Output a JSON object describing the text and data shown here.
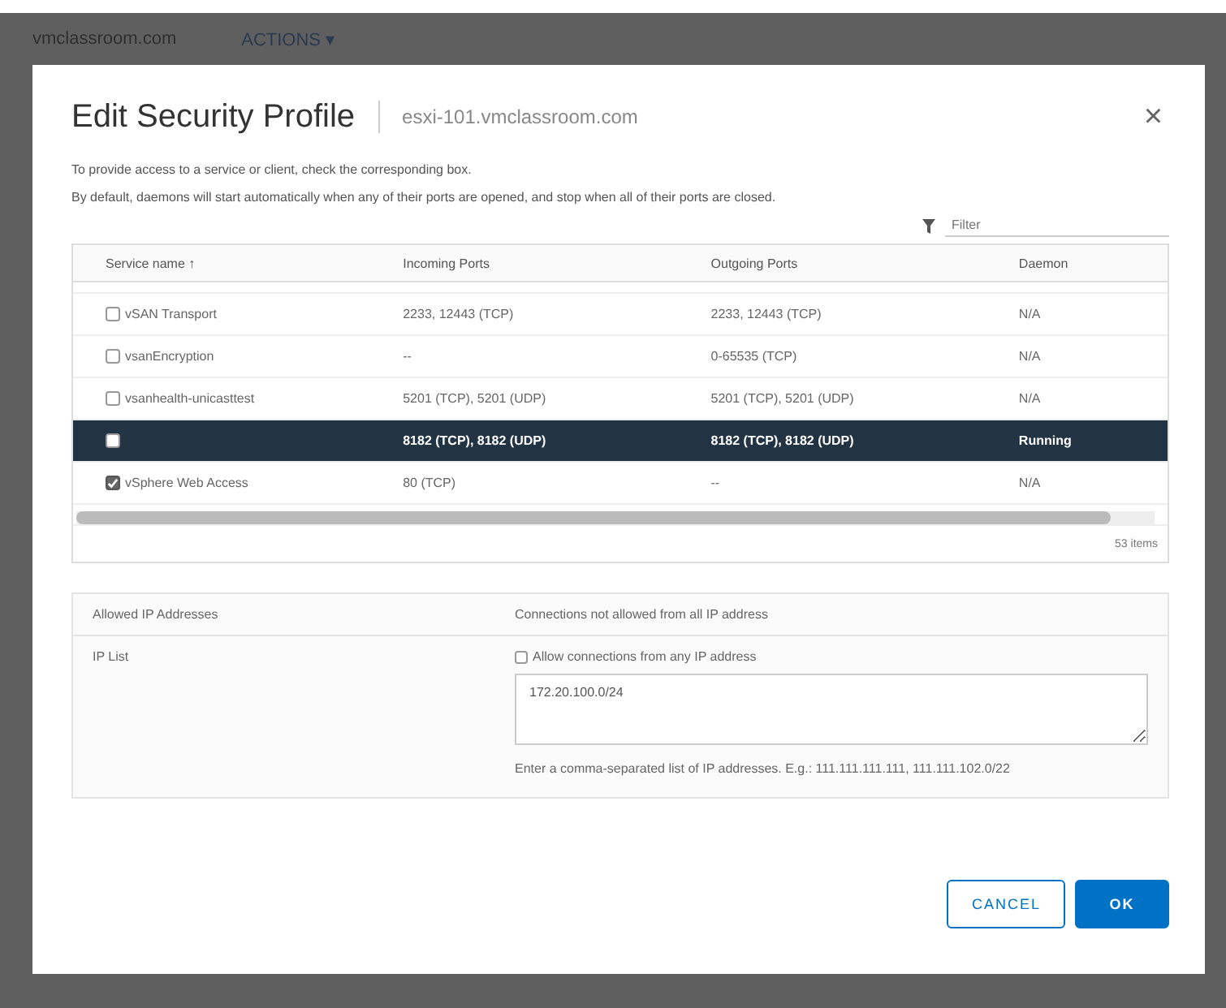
{
  "backdrop": {
    "host": "vmclassroom.com",
    "actions": "ACTIONS ▾"
  },
  "dialog": {
    "title": "Edit Security Profile",
    "subtitle": "esxi-101.vmclassroom.com",
    "close": "×",
    "intro": [
      "To provide access to a service or client, check the corresponding box.",
      "By default, daemons will start automatically when any of their ports are opened, and stop when all of their ports are closed."
    ],
    "filter": {
      "placeholder": "Filter"
    },
    "table": {
      "columns": [
        "Service name ↑",
        "Incoming Ports",
        "Outgoing Ports",
        "Daemon"
      ],
      "rows": [
        {
          "checked": false,
          "selected": false,
          "cells": [
            "vSAN Transport",
            "2233, 12443 (TCP)",
            "2233, 12443 (TCP)",
            "N/A"
          ]
        },
        {
          "checked": false,
          "selected": false,
          "cells": [
            "vsanEncryption",
            "--",
            "0-65535 (TCP)",
            "N/A"
          ]
        },
        {
          "checked": false,
          "selected": false,
          "cells": [
            "vsanhealth-unicasttest",
            "5201 (TCP), 5201 (UDP)",
            "5201 (TCP), 5201 (UDP)",
            "N/A"
          ]
        },
        {
          "checked": false,
          "selected": true,
          "cells": [
            "",
            "8182 (TCP), 8182 (UDP)",
            "8182 (TCP), 8182 (UDP)",
            "Running"
          ]
        },
        {
          "checked": true,
          "selected": false,
          "cells": [
            "vSphere Web Access",
            "80 (TCP)",
            "--",
            "N/A"
          ]
        }
      ],
      "footer": "53 items"
    },
    "ip": {
      "header_label": "Allowed IP Addresses",
      "header_value": "Connections not allowed from all IP address",
      "list_label": "IP List",
      "allow_any": {
        "label": "Allow connections from any IP address",
        "checked": false
      },
      "value": "172.20.100.0/24",
      "hint": "Enter a comma-separated list of IP addresses. E.g.: 111.111.111.111, 111.111.102.0/22"
    },
    "buttons": [
      {
        "label": "CANCEL",
        "kind": "secondary"
      },
      {
        "label": "OK",
        "kind": "primary"
      }
    ]
  }
}
